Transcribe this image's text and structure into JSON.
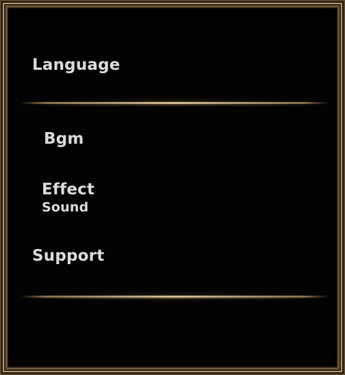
{
  "settings": {
    "language_label": "Language",
    "bgm_label": "Bgm",
    "effect_label_line1": "Effect",
    "effect_label_line2": "Sound",
    "support_label": "Support"
  },
  "colors": {
    "background": "#040303",
    "frame_gold": "#b89a70",
    "text": "#dcdcdc"
  }
}
